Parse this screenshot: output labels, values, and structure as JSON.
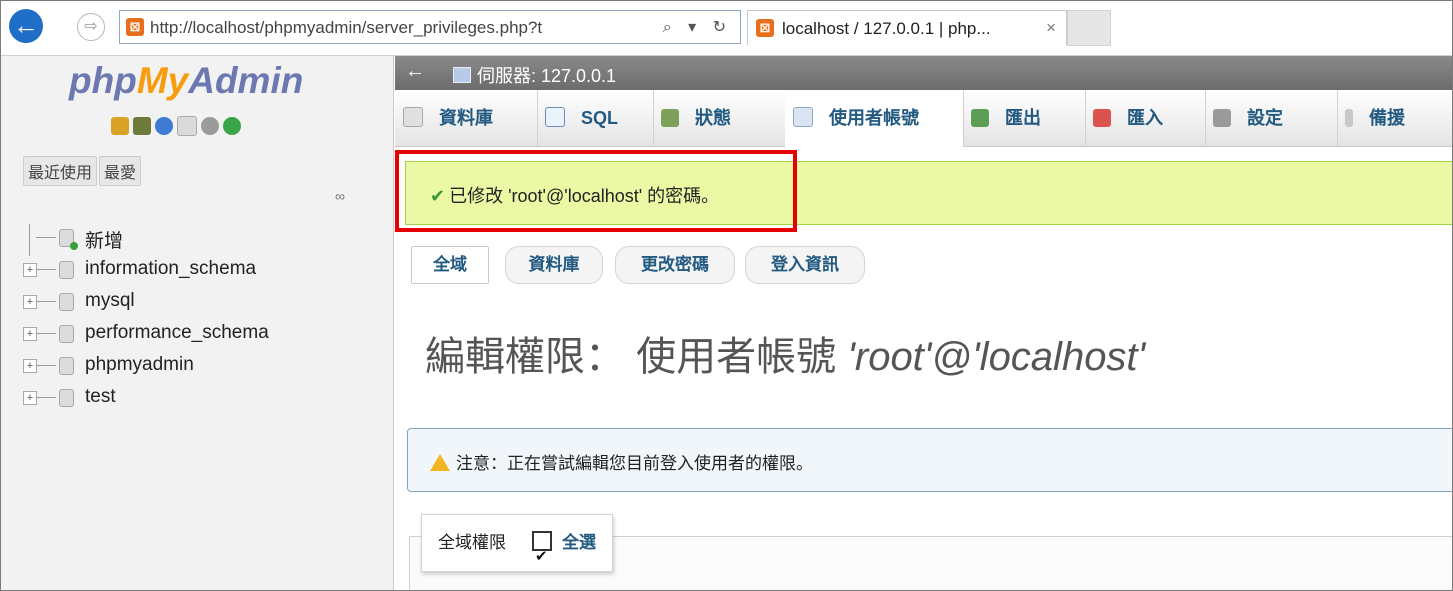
{
  "browser": {
    "url": "http://localhost/phpmyadmin/server_privileges.php?t",
    "tab_title": "localhost / 127.0.0.1 | php...",
    "tab_close": "×",
    "back": "←",
    "forward": "⇨",
    "search_refresh": "⌕ ▾ ↻",
    "favicon": "⊠"
  },
  "nav": {
    "logo": {
      "php": "php",
      "my": "My",
      "admin": "Admin"
    },
    "tabs": [
      "最近使用",
      "最愛"
    ],
    "link_icon": "∞",
    "tree": [
      {
        "label": "新增",
        "type": "new"
      },
      {
        "label": "information_schema",
        "type": "db"
      },
      {
        "label": "mysql",
        "type": "db"
      },
      {
        "label": "performance_schema",
        "type": "db"
      },
      {
        "label": "phpmyadmin",
        "type": "db"
      },
      {
        "label": "test",
        "type": "db"
      }
    ],
    "expander": "+"
  },
  "topbar": {
    "back": "←",
    "server": "伺服器: 127.0.0.1"
  },
  "menu": [
    {
      "label": "資料庫",
      "icon": "database-icon"
    },
    {
      "label": "SQL",
      "icon": "sql-icon"
    },
    {
      "label": "狀態",
      "icon": "status-icon"
    },
    {
      "label": "使用者帳號",
      "icon": "user-accounts-icon",
      "active": true
    },
    {
      "label": "匯出",
      "icon": "export-icon"
    },
    {
      "label": "匯入",
      "icon": "import-icon"
    },
    {
      "label": "設定",
      "icon": "settings-icon"
    },
    {
      "label": "備援",
      "icon": "replication-icon"
    }
  ],
  "success_message": {
    "check": "✔",
    "text": "已修改 'root'@'localhost' 的密碼。"
  },
  "subtabs": [
    "全域",
    "資料庫",
    "更改密碼",
    "登入資訊"
  ],
  "page_title": {
    "prefix": "編輯權限： 使用者帳號 ",
    "account": "'root'@'localhost'"
  },
  "notice": {
    "text": "注意：正在嘗試編輯您目前登入使用者的權限。"
  },
  "privileges": {
    "legend": "全域權限",
    "select_all": "全選",
    "checked": true
  },
  "colors": {
    "success_bg": "#ebf8a4",
    "highlight": "#e60000",
    "link": "#235a81"
  }
}
